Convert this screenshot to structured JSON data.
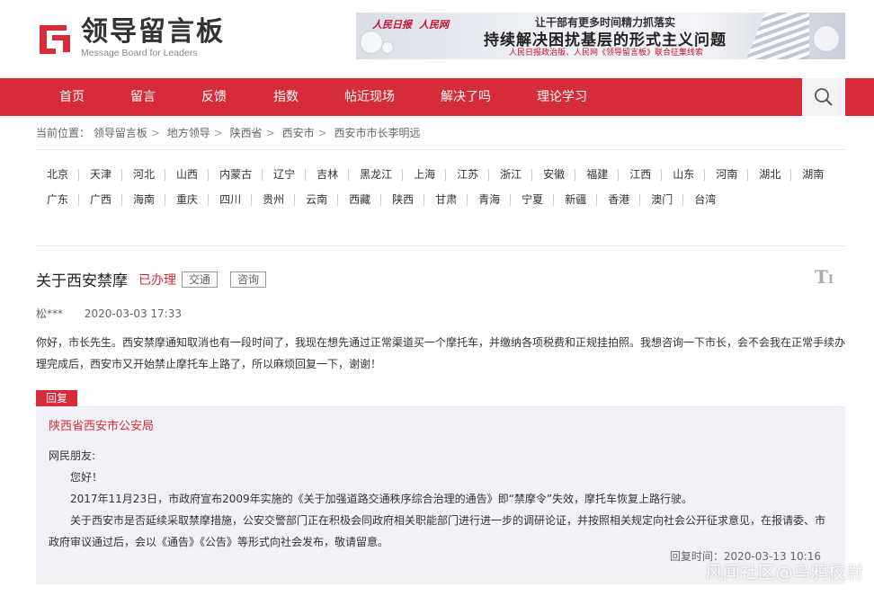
{
  "brand": {
    "name_cn": "领导留言板",
    "name_en": "Message Board for Leaders",
    "color": "#d62c3a"
  },
  "banner": {
    "logo1": "人民日报",
    "logo2": "人民网",
    "line1": "让干部有更多时间精力抓落实",
    "line2": "持续解决困扰基层的形式主义问题",
    "line3": "人民日报政治版、人民网《领导留言板》联合征集线索"
  },
  "nav": {
    "items": [
      "首页",
      "留言",
      "反馈",
      "指数",
      "帖近现场",
      "解决了吗",
      "理论学习"
    ],
    "search_icon": "search-icon"
  },
  "breadcrumb": {
    "prefix": "当前位置：",
    "items": [
      "领导留言板",
      "地方领导",
      "陕西省",
      "西安市",
      "西安市市长李明远"
    ]
  },
  "provinces": {
    "row1": [
      "北京",
      "天津",
      "河北",
      "山西",
      "内蒙古",
      "辽宁",
      "吉林",
      "黑龙江",
      "上海",
      "江苏",
      "浙江",
      "安徽",
      "福建",
      "江西",
      "山东",
      "河南",
      "湖北",
      "湖南"
    ],
    "row2": [
      "广东",
      "广西",
      "海南",
      "重庆",
      "四川",
      "贵州",
      "云南",
      "西藏",
      "陕西",
      "甘肃",
      "青海",
      "宁夏",
      "新疆",
      "香港",
      "澳门",
      "台湾"
    ]
  },
  "letter": {
    "title": "关于西安禁摩",
    "status": "已办理",
    "tags": [
      "交通",
      "咨询"
    ],
    "author": "松***",
    "date": "2020-03-03 17:33",
    "content": "你好，市长先生。西安禁摩通知取消也有一段时间了，我现在想先通过正常渠道买一个摩托车，并缴纳各项税费和正规挂拍照。我想咨询一下市长，会不会我在正常手续办理完成后，西安市又开始禁止摩托车上路了，所以麻烦回复一下，谢谢！",
    "font_icon": "font-size-icon"
  },
  "reply": {
    "label": "回复",
    "org": "陕西省西安市公安局",
    "salutation": "网民朋友:",
    "greeting": "您好！",
    "p1": "2017年11月23日，市政府宣布2009年实施的《关于加强道路交通秩序综合治理的通告》即“禁摩令”失效，摩托车恢复上路行驶。",
    "p2": "关于西安市是否延续采取禁摩措施，公安交警部门正在积极会同政府相关职能部门进行进一步的调研论证，并按照相关规定向社会公开征求意见，在报请委、市政府审议通过后，会以《通告》《公告》等形式向社会发布，敬请留意。",
    "time_label": "回复时间：",
    "time": "2020-03-13 10:16"
  },
  "watermark": "风闻社区@乌鸦校尉"
}
